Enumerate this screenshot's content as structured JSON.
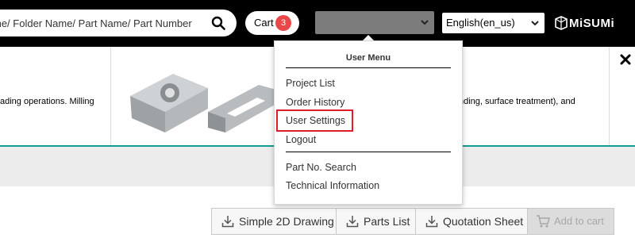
{
  "header": {
    "search_placeholder": "me/ Folder Name/ Part Name/ Part Number",
    "cart_label": "Cart",
    "cart_count": "3",
    "language": "English(en_us)",
    "logo_text": "MiSUMi"
  },
  "banner": {
    "left_text": "ading operations. Milling",
    "right_text": "nding, surface treatment), and"
  },
  "user_menu": {
    "title": "User Menu",
    "items": [
      "Project List",
      "Order History",
      "User Settings",
      "Logout"
    ],
    "secondary_items": [
      "Part No. Search",
      "Technical Information"
    ],
    "highlighted_item": "User Settings"
  },
  "toolbar": {
    "simple_2d": "Simple 2D Drawing",
    "parts_list": "Parts List",
    "quotation_sheet": "Quotation Sheet",
    "add_to_cart": "Add to cart"
  },
  "colors": {
    "topbar": "#000000",
    "accent_teal": "#139c91",
    "cart_badge": "#e84848",
    "highlight_red": "#e01c24"
  }
}
